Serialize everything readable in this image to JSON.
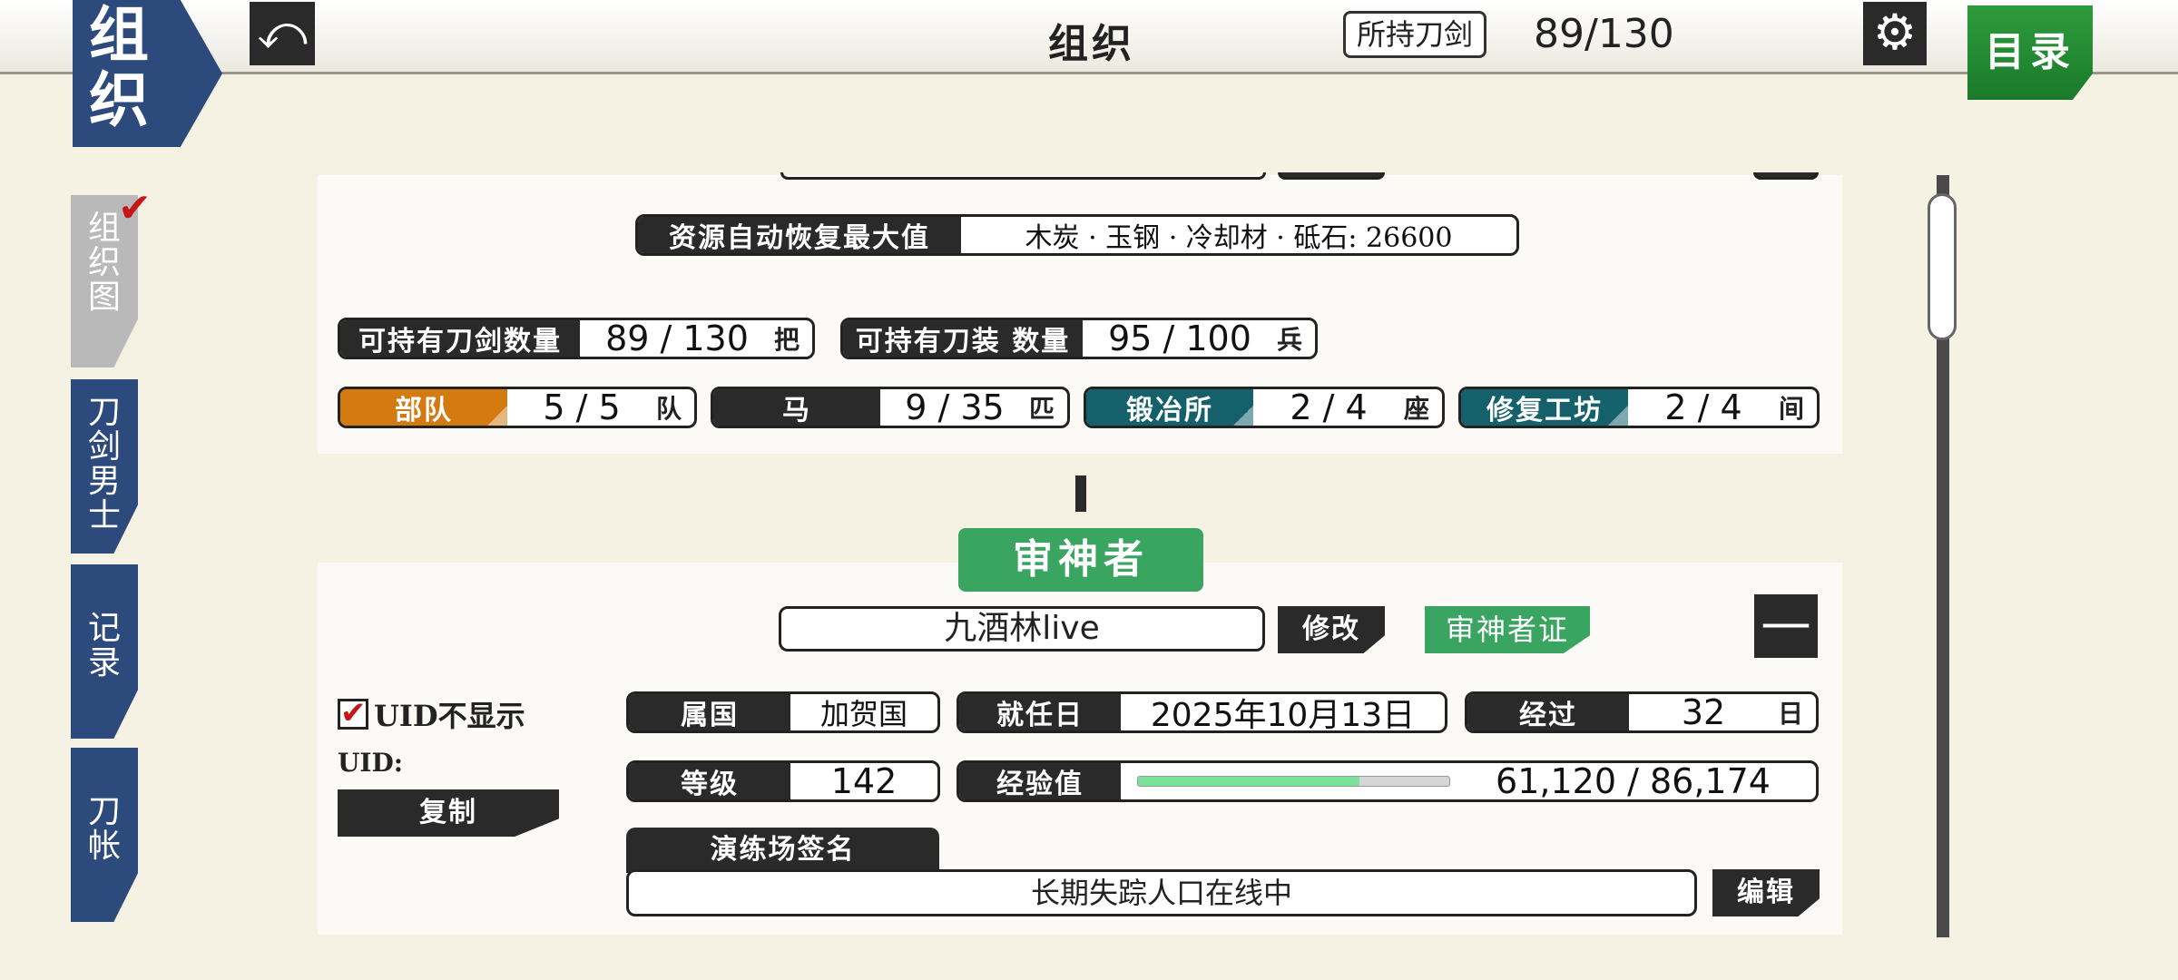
{
  "header": {
    "corner_badge": [
      "组",
      "织"
    ],
    "back_icon": "back-arrow-icon",
    "title": "组织",
    "swords_label": "所持刀剑",
    "swords_count": "89/130",
    "settings_icon": "gear-icon",
    "menu_label": "目录"
  },
  "sidebar": {
    "tabs": [
      {
        "label": [
          "组",
          "织",
          "图"
        ],
        "active": true,
        "checked": true
      },
      {
        "label": [
          "刀",
          "剑",
          "男",
          "士"
        ],
        "active": false
      },
      {
        "label": [
          "记",
          "录"
        ],
        "active": false
      },
      {
        "label": [
          "刀",
          "帐"
        ],
        "active": false
      }
    ]
  },
  "citadel": {
    "resource_max": {
      "label": "资源自动恢复最大值",
      "value": "木炭 · 玉钢 · 冷却材 · 砥石:  26600"
    },
    "sword_capacity": {
      "label": "可持有刀剑数量",
      "value": "89 / 130",
      "unit": "把"
    },
    "equipment_capacity": {
      "label": "可持有刀装 数量",
      "value": "95 / 100",
      "unit": "兵"
    },
    "stats": [
      {
        "label": "部队",
        "value": "5 / 5",
        "unit": "队",
        "color": "#d37a10"
      },
      {
        "label": "马",
        "value": "9 / 35",
        "unit": "匹",
        "color": "#2a2a2a"
      },
      {
        "label": "锻冶所",
        "value": "2 / 4",
        "unit": "座",
        "color": "#14606b"
      },
      {
        "label": "修复工坊",
        "value": "2 / 4",
        "unit": "间",
        "color": "#14606b"
      }
    ]
  },
  "saniwa": {
    "header": "审神者",
    "name": "九酒林live",
    "edit_label": "修改",
    "card_label": "审神者证",
    "collapse_label": "—",
    "hide_uid_label": "UID不显示",
    "hide_uid_checked": true,
    "uid_label": "UID:",
    "copy_label": "复制",
    "province": {
      "label": "属国",
      "value": "加贺国"
    },
    "start_date": {
      "label": "就任日",
      "value": "2025年10月13日"
    },
    "elapsed": {
      "label": "经过",
      "value": "32",
      "unit": "日"
    },
    "level": {
      "label": "等级",
      "value": "142"
    },
    "exp": {
      "label": "经验值",
      "value": "61,120 / 86,174",
      "progress": 0.71
    },
    "signature_tab": "演练场签名",
    "signature": "长期失踪人口在线中",
    "signature_edit": "编辑"
  }
}
